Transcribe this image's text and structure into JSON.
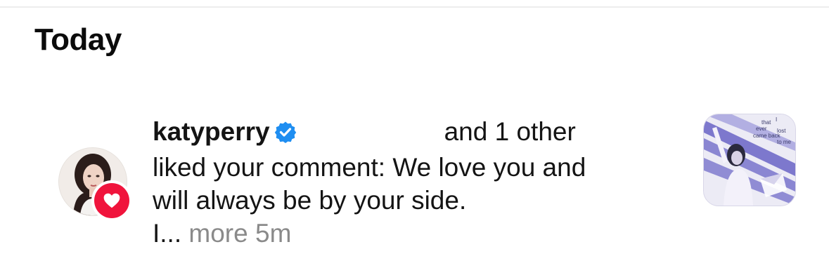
{
  "section": {
    "title": "Today"
  },
  "notification": {
    "username": "katyperry",
    "verified": true,
    "others_text": "and 1 other",
    "line2": "liked your comment: We love you and",
    "line3": "will always be by your side.",
    "truncated": "I...",
    "more_label": "more",
    "timestamp": "5m",
    "badge_icon": "heart-icon",
    "thumbnail_words": [
      "that",
      "I",
      "ever",
      "lost",
      "came back",
      "to me"
    ]
  },
  "colors": {
    "badge_red": "#f0143c",
    "verified_blue": "#1f8ef1",
    "muted_gray": "#8a8a8a",
    "thumb_purple": "#6a64c6"
  }
}
